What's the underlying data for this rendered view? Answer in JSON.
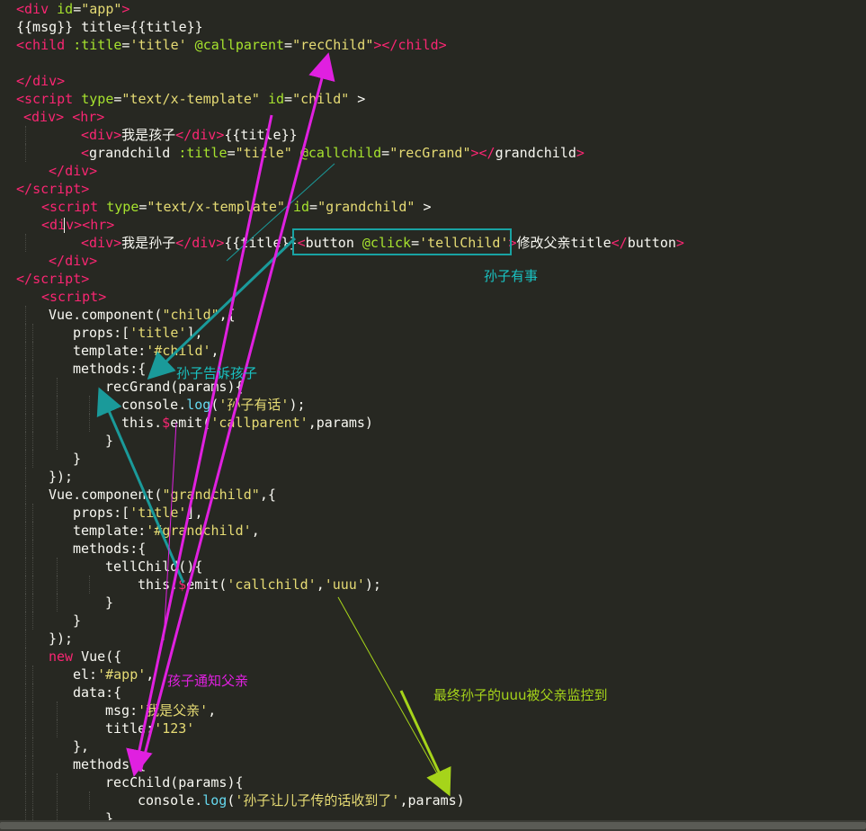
{
  "code_lines": [
    {
      "indent": 0,
      "guides": [],
      "tokens": [
        {
          "t": "<",
          "c": "tag"
        },
        {
          "t": "div",
          "c": "tag"
        },
        {
          "t": " id",
          "c": "attr"
        },
        {
          "t": "=",
          "c": "punc"
        },
        {
          "t": "\"app\"",
          "c": "str"
        },
        {
          "t": ">",
          "c": "tag"
        }
      ]
    },
    {
      "indent": 0,
      "guides": [],
      "tokens": [
        {
          "t": "{{msg}} title={{title}}",
          "c": "punc"
        }
      ]
    },
    {
      "indent": 0,
      "guides": [],
      "tokens": [
        {
          "t": "<",
          "c": "tag"
        },
        {
          "t": "child",
          "c": "tag"
        },
        {
          "t": " :title",
          "c": "attr"
        },
        {
          "t": "=",
          "c": "punc"
        },
        {
          "t": "'title'",
          "c": "str"
        },
        {
          "t": " @callparent",
          "c": "attr"
        },
        {
          "t": "=",
          "c": "punc"
        },
        {
          "t": "\"recChild\"",
          "c": "str"
        },
        {
          "t": ">",
          "c": "tag"
        },
        {
          "t": "</",
          "c": "tag"
        },
        {
          "t": "child",
          "c": "tag"
        },
        {
          "t": ">",
          "c": "tag"
        }
      ]
    },
    {
      "indent": 0,
      "guides": [],
      "tokens": []
    },
    {
      "indent": 0,
      "guides": [],
      "tokens": [
        {
          "t": "</",
          "c": "tag"
        },
        {
          "t": "div",
          "c": "tag"
        },
        {
          "t": ">",
          "c": "tag"
        }
      ]
    },
    {
      "indent": 0,
      "guides": [],
      "tokens": [
        {
          "t": "<",
          "c": "tag"
        },
        {
          "t": "script",
          "c": "tag"
        },
        {
          "t": " type",
          "c": "attr"
        },
        {
          "t": "=",
          "c": "punc"
        },
        {
          "t": "\"text/x-template\"",
          "c": "str"
        },
        {
          "t": " id",
          "c": "attr"
        },
        {
          "t": "=",
          "c": "punc"
        },
        {
          "t": "\"child\"",
          "c": "str"
        },
        {
          "t": " >",
          "c": "punc"
        }
      ]
    },
    {
      "indent": 8,
      "guides": [],
      "tokens": [
        {
          "t": "<",
          "c": "tag"
        },
        {
          "t": "div",
          "c": "tag"
        },
        {
          "t": ">",
          "c": "tag"
        },
        {
          "t": " ",
          "c": "punc"
        },
        {
          "t": "<",
          "c": "tag"
        },
        {
          "t": "hr",
          "c": "tag"
        },
        {
          "t": ">",
          "c": "tag"
        }
      ]
    },
    {
      "indent": 72,
      "guides": [
        28
      ],
      "tokens": [
        {
          "t": "<",
          "c": "tag"
        },
        {
          "t": "div",
          "c": "tag"
        },
        {
          "t": ">",
          "c": "tag"
        },
        {
          "t": "我是孩子",
          "c": "punc"
        },
        {
          "t": "</",
          "c": "tag"
        },
        {
          "t": "div",
          "c": "tag"
        },
        {
          "t": ">",
          "c": "tag"
        },
        {
          "t": "{{title}}",
          "c": "punc"
        }
      ]
    },
    {
      "indent": 72,
      "guides": [
        28
      ],
      "tokens": [
        {
          "t": "<",
          "c": "tag"
        },
        {
          "t": "grandchild",
          "c": "punc"
        },
        {
          "t": " :title",
          "c": "attr"
        },
        {
          "t": "=",
          "c": "punc"
        },
        {
          "t": "\"title\"",
          "c": "str"
        },
        {
          "t": " @callchild",
          "c": "attr"
        },
        {
          "t": "=",
          "c": "punc"
        },
        {
          "t": "\"recGrand\"",
          "c": "str"
        },
        {
          "t": ">",
          "c": "tag"
        },
        {
          "t": "</",
          "c": "tag"
        },
        {
          "t": "grandchild",
          "c": "punc"
        },
        {
          "t": ">",
          "c": "tag"
        }
      ]
    },
    {
      "indent": 36,
      "guides": [],
      "tokens": [
        {
          "t": "</",
          "c": "tag"
        },
        {
          "t": "div",
          "c": "tag"
        },
        {
          "t": ">",
          "c": "tag"
        }
      ]
    },
    {
      "indent": 0,
      "guides": [],
      "tokens": [
        {
          "t": "</",
          "c": "tag"
        },
        {
          "t": "script",
          "c": "tag"
        },
        {
          "t": ">",
          "c": "tag"
        }
      ]
    },
    {
      "indent": 28,
      "guides": [],
      "tokens": [
        {
          "t": "<",
          "c": "tag"
        },
        {
          "t": "script",
          "c": "tag"
        },
        {
          "t": " type",
          "c": "attr"
        },
        {
          "t": "=",
          "c": "punc"
        },
        {
          "t": "\"text/x-template\"",
          "c": "str"
        },
        {
          "t": " id",
          "c": "attr"
        },
        {
          "t": "=",
          "c": "punc"
        },
        {
          "t": "\"grandchild\"",
          "c": "str"
        },
        {
          "t": " >",
          "c": "punc"
        }
      ]
    },
    {
      "indent": 28,
      "guides": [],
      "tokens": [
        {
          "t": "<",
          "c": "tag"
        },
        {
          "t": "div",
          "c": "tag"
        },
        {
          "t": ">",
          "c": "tag"
        },
        {
          "t": "<",
          "c": "tag"
        },
        {
          "t": "hr",
          "c": "tag"
        },
        {
          "t": ">",
          "c": "tag"
        }
      ]
    },
    {
      "indent": 72,
      "guides": [
        28
      ],
      "tokens": [
        {
          "t": "<",
          "c": "tag"
        },
        {
          "t": "div",
          "c": "tag"
        },
        {
          "t": ">",
          "c": "tag"
        },
        {
          "t": "我是孙子",
          "c": "punc"
        },
        {
          "t": "</",
          "c": "tag"
        },
        {
          "t": "div",
          "c": "tag"
        },
        {
          "t": ">",
          "c": "tag"
        },
        {
          "t": "{{title}}",
          "c": "punc"
        },
        {
          "t": "<",
          "c": "tag"
        },
        {
          "t": "button",
          "c": "punc"
        },
        {
          "t": " @click",
          "c": "attr"
        },
        {
          "t": "=",
          "c": "punc"
        },
        {
          "t": "'tellChild'",
          "c": "str"
        },
        {
          "t": ">",
          "c": "tag"
        },
        {
          "t": "修改父亲title",
          "c": "punc"
        },
        {
          "t": "</",
          "c": "tag"
        },
        {
          "t": "button",
          "c": "punc"
        },
        {
          "t": ">",
          "c": "tag"
        }
      ]
    },
    {
      "indent": 36,
      "guides": [],
      "tokens": [
        {
          "t": "</",
          "c": "tag"
        },
        {
          "t": "div",
          "c": "tag"
        },
        {
          "t": ">",
          "c": "tag"
        }
      ]
    },
    {
      "indent": 0,
      "guides": [],
      "tokens": [
        {
          "t": "</",
          "c": "tag"
        },
        {
          "t": "script",
          "c": "tag"
        },
        {
          "t": ">",
          "c": "tag"
        }
      ]
    },
    {
      "indent": 28,
      "guides": [],
      "tokens": [
        {
          "t": "<",
          "c": "tag"
        },
        {
          "t": "script",
          "c": "tag"
        },
        {
          "t": ">",
          "c": "tag"
        }
      ]
    },
    {
      "indent": 36,
      "guides": [
        28
      ],
      "tokens": [
        {
          "t": "Vue.component(",
          "c": "punc"
        },
        {
          "t": "\"child\"",
          "c": "str"
        },
        {
          "t": ",{",
          "c": "punc"
        }
      ]
    },
    {
      "indent": 63,
      "guides": [
        28,
        36
      ],
      "tokens": [
        {
          "t": "props:[",
          "c": "punc"
        },
        {
          "t": "'title'",
          "c": "str"
        },
        {
          "t": "],",
          "c": "punc"
        }
      ]
    },
    {
      "indent": 63,
      "guides": [
        28,
        36
      ],
      "tokens": [
        {
          "t": "template:",
          "c": "punc"
        },
        {
          "t": "'#child'",
          "c": "str"
        },
        {
          "t": ",",
          "c": "punc"
        }
      ]
    },
    {
      "indent": 63,
      "guides": [
        28,
        36
      ],
      "tokens": [
        {
          "t": "methods:{",
          "c": "punc"
        }
      ]
    },
    {
      "indent": 99,
      "guides": [
        28,
        36,
        63
      ],
      "tokens": [
        {
          "t": "recGrand(params){",
          "c": "punc"
        }
      ]
    },
    {
      "indent": 117,
      "guides": [
        28,
        36,
        63,
        99
      ],
      "tokens": [
        {
          "t": "console.",
          "c": "punc"
        },
        {
          "t": "log",
          "c": "fn"
        },
        {
          "t": "(",
          "c": "punc"
        },
        {
          "t": "'孙子有话'",
          "c": "str"
        },
        {
          "t": ");",
          "c": "punc"
        }
      ]
    },
    {
      "indent": 117,
      "guides": [
        28,
        36,
        63,
        99
      ],
      "tokens": [
        {
          "t": "this.",
          "c": "punc"
        },
        {
          "t": "$",
          "c": "kw"
        },
        {
          "t": "emit(",
          "c": "punc"
        },
        {
          "t": "'callparent'",
          "c": "str"
        },
        {
          "t": ",params)",
          "c": "punc"
        }
      ]
    },
    {
      "indent": 99,
      "guides": [
        28,
        36,
        63
      ],
      "tokens": [
        {
          "t": "}",
          "c": "punc"
        }
      ]
    },
    {
      "indent": 63,
      "guides": [
        28,
        36
      ],
      "tokens": [
        {
          "t": "}",
          "c": "punc"
        }
      ]
    },
    {
      "indent": 36,
      "guides": [
        28
      ],
      "tokens": [
        {
          "t": "});",
          "c": "punc"
        }
      ]
    },
    {
      "indent": 36,
      "guides": [
        28
      ],
      "tokens": [
        {
          "t": "Vue.component(",
          "c": "punc"
        },
        {
          "t": "\"grandchild\"",
          "c": "str"
        },
        {
          "t": ",{",
          "c": "punc"
        }
      ]
    },
    {
      "indent": 63,
      "guides": [
        28,
        36
      ],
      "tokens": [
        {
          "t": "props:[",
          "c": "punc"
        },
        {
          "t": "'title'",
          "c": "str"
        },
        {
          "t": "],",
          "c": "punc"
        }
      ]
    },
    {
      "indent": 63,
      "guides": [
        28,
        36
      ],
      "tokens": [
        {
          "t": "template:",
          "c": "punc"
        },
        {
          "t": "'#grandchild'",
          "c": "str"
        },
        {
          "t": ",",
          "c": "punc"
        }
      ]
    },
    {
      "indent": 63,
      "guides": [
        28,
        36
      ],
      "tokens": [
        {
          "t": "methods:{",
          "c": "punc"
        }
      ]
    },
    {
      "indent": 99,
      "guides": [
        28,
        36,
        63
      ],
      "tokens": [
        {
          "t": "tellChild(){",
          "c": "punc"
        }
      ]
    },
    {
      "indent": 135,
      "guides": [
        28,
        36,
        63,
        99
      ],
      "tokens": [
        {
          "t": "this.",
          "c": "punc"
        },
        {
          "t": "$",
          "c": "kw"
        },
        {
          "t": "emit(",
          "c": "punc"
        },
        {
          "t": "'callchild'",
          "c": "str"
        },
        {
          "t": ",",
          "c": "punc"
        },
        {
          "t": "'uuu'",
          "c": "str"
        },
        {
          "t": ");",
          "c": "punc"
        }
      ]
    },
    {
      "indent": 99,
      "guides": [
        28,
        36,
        63
      ],
      "tokens": [
        {
          "t": "}",
          "c": "punc"
        }
      ]
    },
    {
      "indent": 63,
      "guides": [
        28,
        36
      ],
      "tokens": [
        {
          "t": "}",
          "c": "punc"
        }
      ]
    },
    {
      "indent": 36,
      "guides": [
        28
      ],
      "tokens": [
        {
          "t": "});",
          "c": "punc"
        }
      ]
    },
    {
      "indent": 36,
      "guides": [
        28
      ],
      "tokens": [
        {
          "t": "new",
          "c": "kw"
        },
        {
          "t": " Vue({",
          "c": "punc"
        }
      ]
    },
    {
      "indent": 63,
      "guides": [
        28,
        36
      ],
      "tokens": [
        {
          "t": "el:",
          "c": "punc"
        },
        {
          "t": "'#app'",
          "c": "str"
        },
        {
          "t": ",",
          "c": "punc"
        }
      ]
    },
    {
      "indent": 63,
      "guides": [
        28,
        36
      ],
      "tokens": [
        {
          "t": "data:{",
          "c": "punc"
        }
      ]
    },
    {
      "indent": 99,
      "guides": [
        28,
        36,
        63
      ],
      "tokens": [
        {
          "t": "msg:",
          "c": "punc"
        },
        {
          "t": "'我是父亲'",
          "c": "str"
        },
        {
          "t": ",",
          "c": "punc"
        }
      ]
    },
    {
      "indent": 99,
      "guides": [
        28,
        36,
        63
      ],
      "tokens": [
        {
          "t": "title:",
          "c": "punc"
        },
        {
          "t": "'123'",
          "c": "str"
        }
      ]
    },
    {
      "indent": 63,
      "guides": [
        28,
        36
      ],
      "tokens": [
        {
          "t": "},",
          "c": "punc"
        }
      ]
    },
    {
      "indent": 63,
      "guides": [
        28,
        36
      ],
      "tokens": [
        {
          "t": "methods:{",
          "c": "punc"
        }
      ]
    },
    {
      "indent": 99,
      "guides": [
        28,
        36,
        63
      ],
      "tokens": [
        {
          "t": "recChild(params){",
          "c": "punc"
        }
      ]
    },
    {
      "indent": 135,
      "guides": [
        28,
        36,
        63,
        99
      ],
      "tokens": [
        {
          "t": "console.",
          "c": "punc"
        },
        {
          "t": "log",
          "c": "fn"
        },
        {
          "t": "(",
          "c": "punc"
        },
        {
          "t": "'孙子让儿子传的话收到了'",
          "c": "str"
        },
        {
          "t": ",params)",
          "c": "punc"
        }
      ]
    },
    {
      "indent": 99,
      "guides": [
        28,
        36,
        63
      ],
      "tokens": [
        {
          "t": "}",
          "c": "punc"
        }
      ]
    }
  ],
  "annotations": {
    "grandson_event": {
      "text": "孙子有事",
      "color": "#19c2c2"
    },
    "grandson_tells_child": {
      "text": "孙子告诉孩子",
      "color": "#19c2c2"
    },
    "child_notifies_parent": {
      "text": "孩子通知父亲",
      "color": "#e020e0"
    },
    "parent_receives": {
      "text": "最终孙子的uuu被父亲监控到",
      "color": "#a6d41a"
    }
  },
  "colors": {
    "background": "#272822",
    "tag": "#F92672",
    "attr": "#A6E22E",
    "string": "#E6DB74",
    "function": "#66D9EF",
    "text": "#F8F8F2",
    "highlight_box": "#19a3a3",
    "arrow_teal": "#1a9a9a",
    "arrow_magenta": "#e020e0",
    "arrow_green": "#a6d41a"
  }
}
